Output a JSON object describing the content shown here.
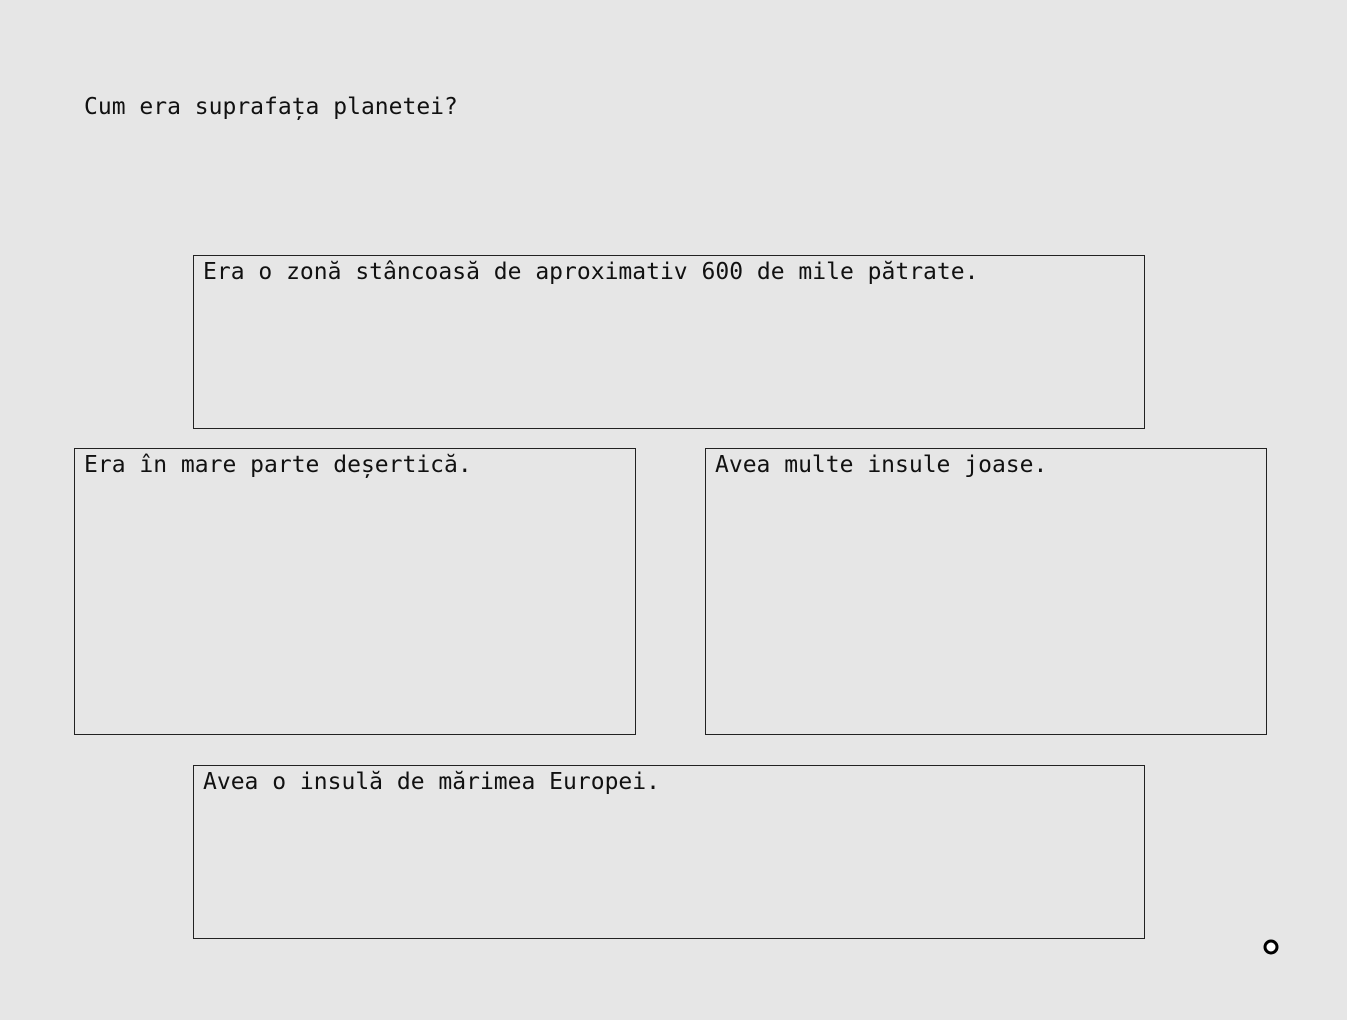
{
  "question": "Cum era suprafața planetei?",
  "options": [
    {
      "id": "a",
      "label": "Era o zonă stâncoasă de aproximativ 600 de mile pătrate."
    },
    {
      "id": "b",
      "label": "Era în mare parte deșertică."
    },
    {
      "id": "c",
      "label": "Avea multe insule joase."
    },
    {
      "id": "d",
      "label": "Avea o insulă de mărimea Europei."
    }
  ],
  "icons": {
    "cursor": "cursor-ring-icon"
  },
  "colors": {
    "background": "#e6e6e6",
    "border": "#222222",
    "text": "#111111"
  }
}
